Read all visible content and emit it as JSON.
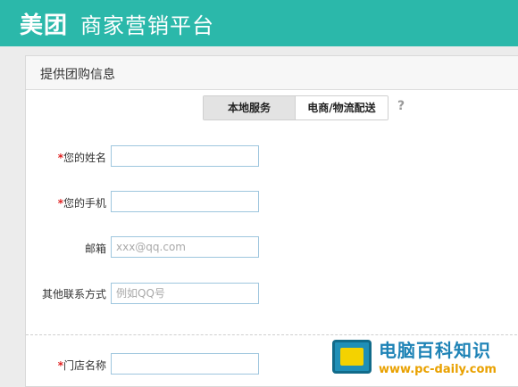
{
  "header": {
    "brand": "美团",
    "subtitle": "商家营销平台",
    "bg_color": "#2bb8aa"
  },
  "panel": {
    "title": "提供团购信息"
  },
  "tabs": [
    {
      "label": "本地服务",
      "active": true
    },
    {
      "label": "电商/物流配送",
      "active": false
    }
  ],
  "help_icon": "?",
  "form": {
    "rows": [
      {
        "required": true,
        "label": "您的姓名",
        "value": "",
        "placeholder": ""
      },
      {
        "required": true,
        "label": "您的手机",
        "value": "",
        "placeholder": ""
      },
      {
        "required": false,
        "label": "邮箱",
        "value": "",
        "placeholder": "xxx@qq.com"
      },
      {
        "required": false,
        "label": "其他联系方式",
        "value": "",
        "placeholder": "例如QQ号"
      },
      {
        "required": true,
        "label": "门店名称",
        "value": "",
        "placeholder": ""
      }
    ]
  },
  "watermark": {
    "title": "电脑百科知识",
    "url": "www.pc-daily.com",
    "icon": "monitor-icon"
  },
  "colors": {
    "accent": "#2bb8aa",
    "required": "#e02020",
    "input_border": "#9ec6de"
  }
}
